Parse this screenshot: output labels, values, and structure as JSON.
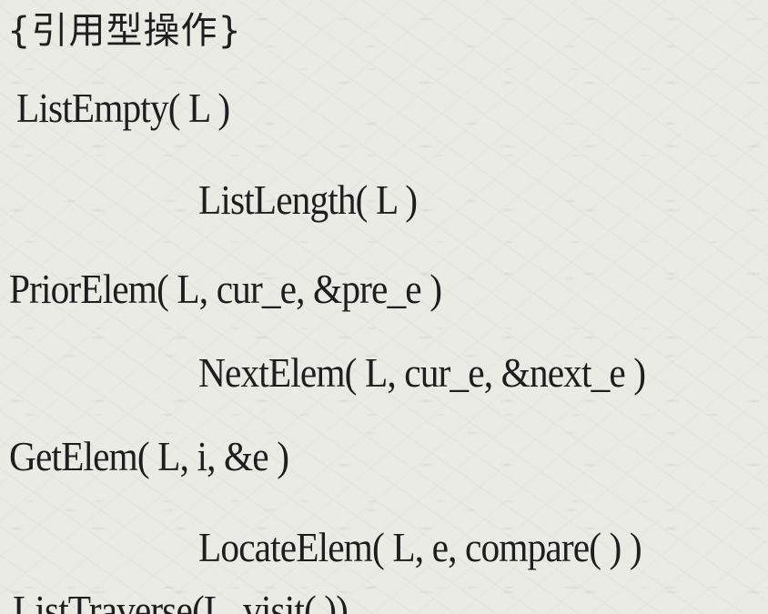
{
  "section": {
    "heading": "{引用型操作}"
  },
  "operations": [
    "ListEmpty( L )",
    "ListLength( L )",
    "PriorElem( L, cur_e, &pre_e )",
    "NextElem( L, cur_e, &next_e )",
    "GetElem( L, i, &e )",
    "LocateElem( L, e, compare( ) )",
    "ListTraverse(L, visit( ))"
  ]
}
